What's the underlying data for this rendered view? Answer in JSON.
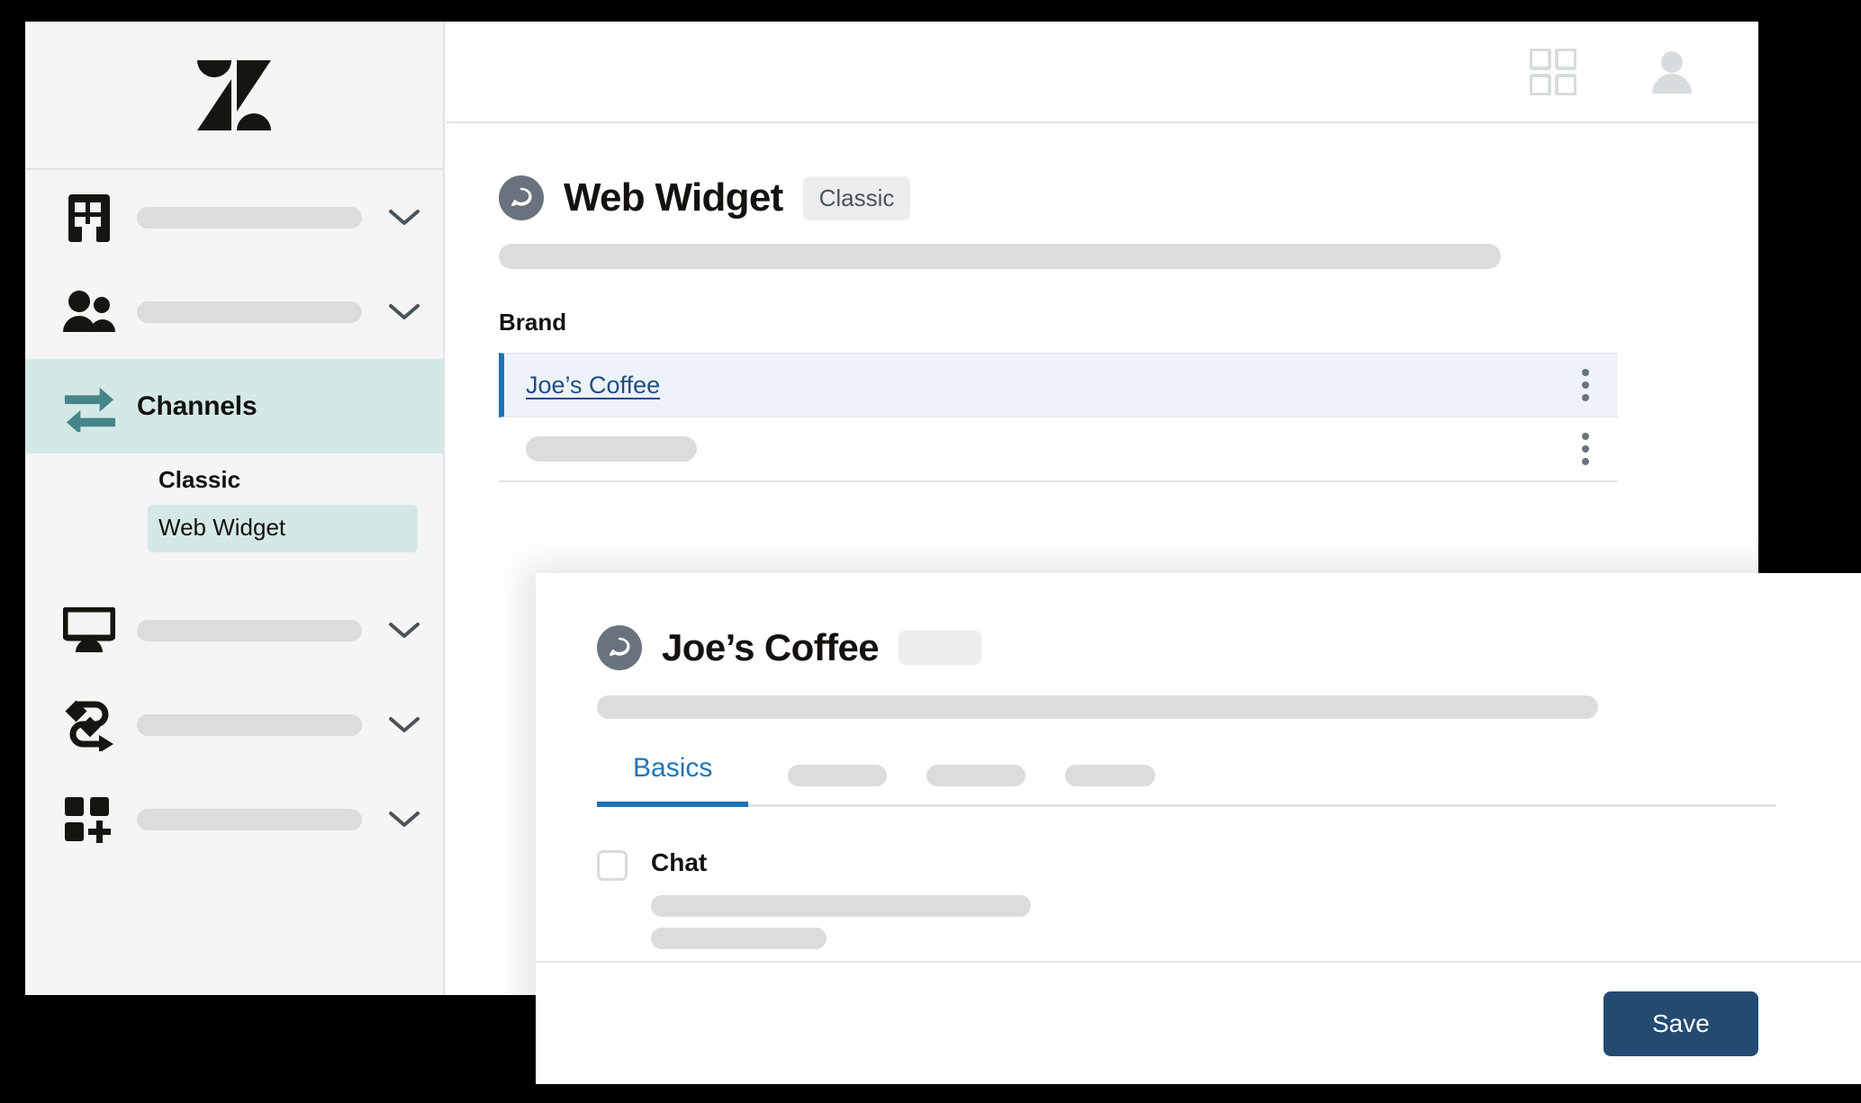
{
  "sidebar": {
    "logo_icon": "zendesk-logo",
    "items": [
      {
        "icon": "building-icon",
        "label": "",
        "placeholder_width": 250,
        "chevron": true,
        "active": false
      },
      {
        "icon": "people-icon",
        "label": "",
        "placeholder_width": 250,
        "chevron": true,
        "active": false
      },
      {
        "icon": "channels-arrows-icon",
        "label": "Channels",
        "placeholder_width": 0,
        "chevron": false,
        "active": true
      },
      {
        "icon": "monitor-icon",
        "label": "",
        "placeholder_width": 250,
        "chevron": true,
        "active": false
      },
      {
        "icon": "workflow-icon",
        "label": "",
        "placeholder_width": 250,
        "chevron": true,
        "active": false
      },
      {
        "icon": "apps-add-icon",
        "label": "",
        "placeholder_width": 250,
        "chevron": true,
        "active": false
      }
    ],
    "subsection": {
      "header": "Classic",
      "items": [
        {
          "label": "Web Widget",
          "active": true
        }
      ]
    }
  },
  "topbar": {
    "apps_icon": "apps-grid-icon",
    "avatar_icon": "user-avatar-icon"
  },
  "main": {
    "icon": "chat-bubble-icon",
    "title": "Web Widget",
    "badge": "Classic",
    "subtitle_placeholder_width": 1113,
    "brand_section_label": "Brand",
    "brand_rows": [
      {
        "type": "link",
        "label": "Joe’s Coffee",
        "selected": true,
        "kebab": "kebab-menu-icon"
      },
      {
        "type": "placeholder",
        "label": "",
        "selected": false,
        "kebab": "kebab-menu-icon"
      }
    ]
  },
  "modal": {
    "icon": "chat-bubble-icon",
    "title": "Joe’s Coffee",
    "badge_placeholder_width": 92,
    "subtitle_placeholder_width": 1112,
    "tabs": [
      {
        "label": "Basics",
        "active": true,
        "placeholder_width": 0
      },
      {
        "label": "",
        "active": false,
        "placeholder_width": 110
      },
      {
        "label": "",
        "active": false,
        "placeholder_width": 110
      },
      {
        "label": "",
        "active": false,
        "placeholder_width": 100
      }
    ],
    "field": {
      "checkbox_checked": false,
      "label": "Chat",
      "lines": [
        422,
        195
      ]
    },
    "footer": {
      "save_label": "Save"
    }
  },
  "colors": {
    "accent_blue": "#1f73b7",
    "save_navy": "#234b72",
    "active_teal": "#d4e9e6",
    "selected_row": "#edf3f8",
    "placeholder_gray": "#dcdcdc",
    "icon_gray": "#68737d",
    "sidebar_bg": "#f5f5f5"
  }
}
